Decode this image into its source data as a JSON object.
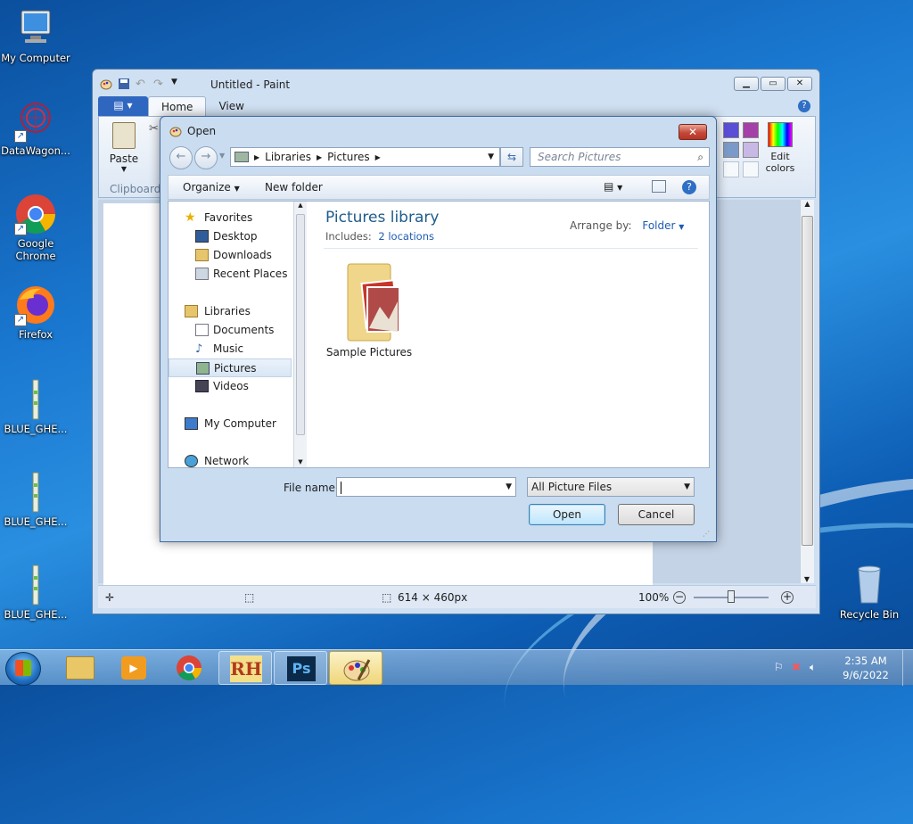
{
  "desktop": {
    "icons": [
      {
        "label": "My Computer"
      },
      {
        "label": "DataWagon..."
      },
      {
        "label": "Google Chrome"
      },
      {
        "label": "Firefox"
      },
      {
        "label": "BLUE_GHE..."
      },
      {
        "label": "BLUE_GHE..."
      },
      {
        "label": "BLUE_GHE..."
      },
      {
        "label": "Recycle Bin"
      }
    ]
  },
  "paint": {
    "title": "Untitled - Paint",
    "file_tab_icon": "paint-menu-icon",
    "tabs": [
      "Home",
      "View"
    ],
    "paste_label": "Paste",
    "clipboard_label": "Clipboard",
    "edit_colors_label": "Edit colors",
    "status": {
      "size": "614 × 460px",
      "zoom": "100%"
    },
    "palette_colors": [
      "#5a4fd6",
      "#a440a8",
      "#7b9ac9",
      "#c8b8e6",
      "#ffffff",
      "#ffffff"
    ]
  },
  "dialog": {
    "title": "Open",
    "address": [
      "Libraries",
      "Pictures"
    ],
    "search_placeholder": "Search Pictures",
    "organize_label": "Organize",
    "new_folder_label": "New folder",
    "nav": {
      "favorites": "Favorites",
      "desktop": "Desktop",
      "downloads": "Downloads",
      "recent": "Recent Places",
      "libraries": "Libraries",
      "documents": "Documents",
      "music": "Music",
      "pictures": "Pictures",
      "videos": "Videos",
      "computer": "My Computer",
      "network": "Network"
    },
    "library_title": "Pictures library",
    "includes_label": "Includes:",
    "includes_link": "2 locations",
    "arrange_label": "Arrange by:",
    "arrange_value": "Folder",
    "items": [
      {
        "label": "Sample Pictures"
      }
    ],
    "filename_label": "File name:",
    "filename_value": "",
    "filetype_value": "All Picture Files",
    "open_label": "Open",
    "cancel_label": "Cancel"
  },
  "taskbar": {
    "time": "2:35 AM",
    "date": "9/6/2022"
  }
}
